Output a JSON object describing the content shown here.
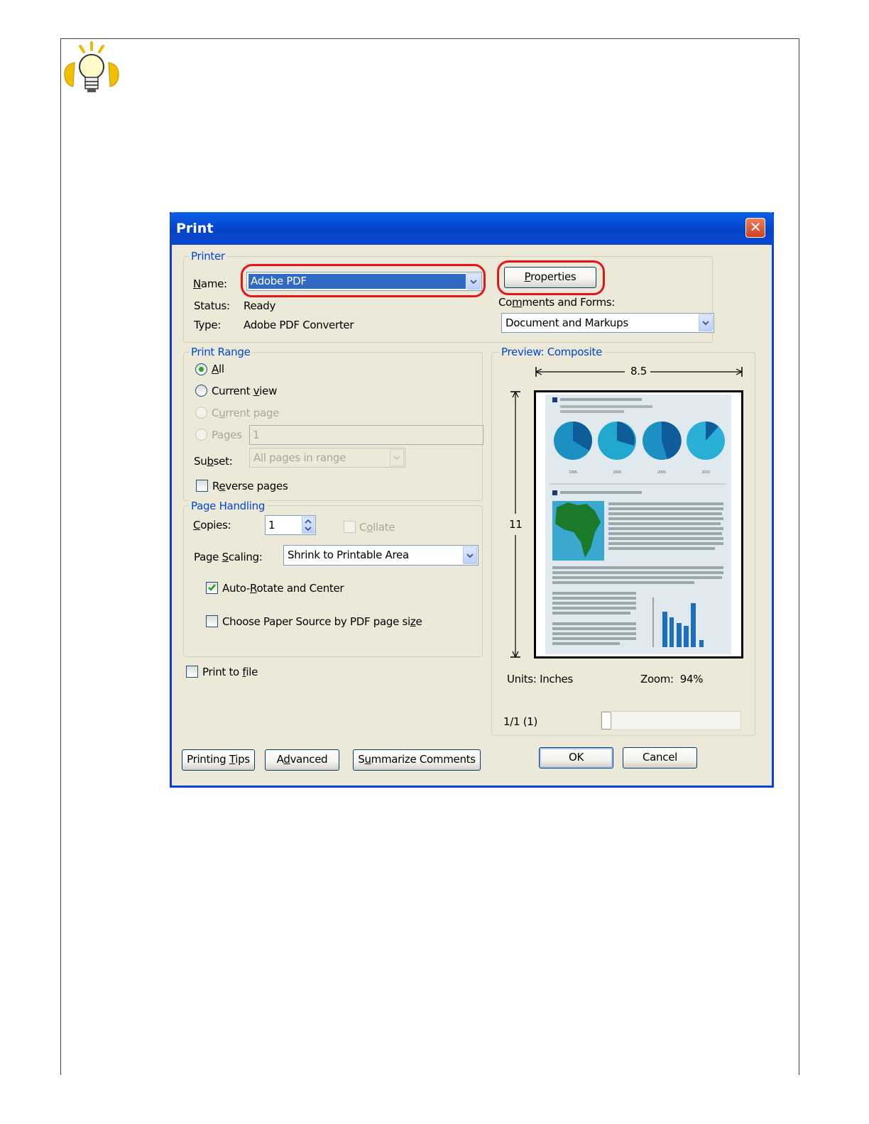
{
  "dialog": {
    "title": "Print",
    "close_symbol": "✕",
    "printer": {
      "legend": "Printer",
      "name_label": "Name:",
      "name_value": "Adobe PDF",
      "status_label": "Status:",
      "status_value": "Ready",
      "type_label": "Type:",
      "type_value": "Adobe PDF Converter",
      "properties_button": "Properties",
      "comments_label": "Comments and Forms:",
      "comments_value": "Document and Markups"
    },
    "print_range": {
      "legend": "Print Range",
      "all": "All",
      "current_view": "Current view",
      "current_page": "Current page",
      "pages": "Pages",
      "pages_value": "1",
      "subset_label": "Subset:",
      "subset_value": "All pages in range",
      "reverse_pages": "Reverse pages"
    },
    "page_handling": {
      "legend": "Page Handling",
      "copies_label": "Copies:",
      "copies_value": "1",
      "collate": "Collate",
      "scaling_label": "Page Scaling:",
      "scaling_value": "Shrink to Printable Area",
      "auto_rotate": "Auto-Rotate and Center",
      "choose_paper": "Choose Paper Source by PDF page size"
    },
    "print_to_file": "Print to file",
    "preview": {
      "legend": "Preview: Composite",
      "width_label": "8.5",
      "height_label": "11",
      "units": "Units: Inches",
      "zoom": "Zoom:  94%",
      "page_indicator": "1/1 (1)",
      "year_labels": [
        "1995",
        "2000",
        "2005",
        "2010"
      ]
    },
    "buttons": {
      "printing_tips": "Printing Tips",
      "advanced": "Advanced",
      "summarize": "Summarize Comments",
      "ok": "OK",
      "cancel": "Cancel"
    }
  },
  "colors": {
    "title_bar": "#0a46cc",
    "highlight_ring": "#e8141c",
    "legend_text": "#0046d5",
    "dialog_bg": "#ece9d8"
  },
  "icons": {
    "tip": "lightbulb-icon"
  }
}
